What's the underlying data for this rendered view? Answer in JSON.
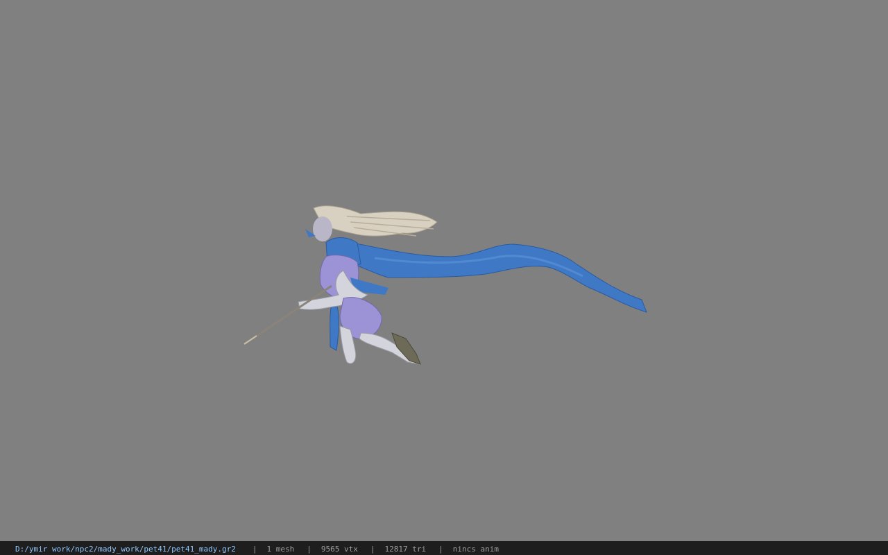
{
  "viewer": {
    "background_color": "#808080",
    "model": {
      "name": "pet41_mady",
      "icon": "character-model",
      "accent_colors": {
        "cape": "#3f78c4",
        "hair": "#d8d0c0",
        "outfit": "#9b93d6",
        "skin": "#d4d4dc"
      }
    }
  },
  "status_bar": {
    "path": "D:/ymir work/npc2/mady_work/pet41/pet41_mady.gr2",
    "separator": "|",
    "mesh": "1 mesh",
    "vertices": "9565 vtx",
    "triangles": "12817 tri",
    "anim": "nincs anim"
  }
}
